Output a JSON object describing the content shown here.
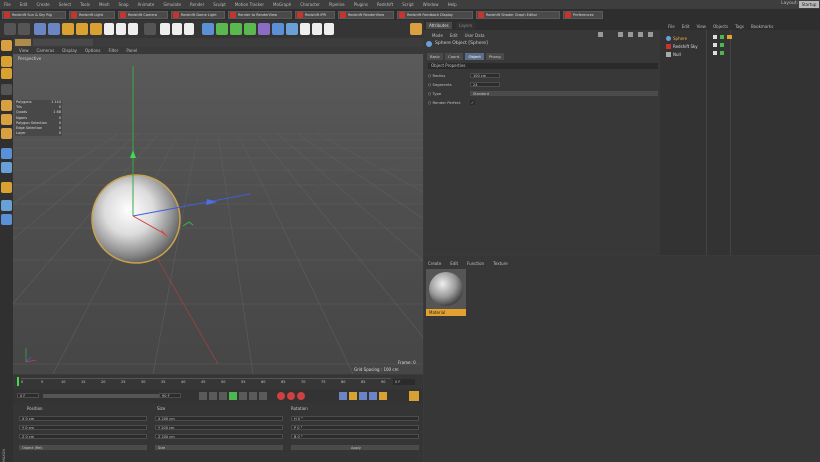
{
  "menubar": {
    "items": [
      "File",
      "Edit",
      "Create",
      "Select",
      "Tools",
      "Mesh",
      "Snap",
      "Animate",
      "Simulate",
      "Render",
      "Sculpt",
      "Motion Tracker",
      "MoGraph",
      "Character",
      "Pipeline",
      "Plugins",
      "Redshift",
      "Script",
      "Window",
      "Help"
    ],
    "layout_label": "Layout:",
    "layout_value": "Startup"
  },
  "plugin_bar": {
    "items": [
      "Redshift Sun & Sky Rig",
      "Redshift Light",
      "Redshift Camera",
      "Redshift Dome Light",
      "Render to RenderView",
      "Redshift IPR",
      "Redshift RenderView",
      "Redshift Feedback Display",
      "Redshift Shader Graph Editor",
      "Preferences"
    ]
  },
  "viewport": {
    "menu": [
      "View",
      "Cameras",
      "Display",
      "Options",
      "Filter",
      "Panel"
    ],
    "label": "Perspective",
    "hud": [
      {
        "k": "Polygons",
        "v": "1 144"
      },
      {
        "k": "Tris",
        "v": "0"
      },
      {
        "k": "Quads",
        "v": "1 88"
      },
      {
        "k": "Ngons",
        "v": "0"
      },
      {
        "k": "Polygon Selection",
        "v": "0"
      },
      {
        "k": "Edge Selection",
        "v": "0"
      },
      {
        "k": "Layer",
        "v": "0"
      }
    ],
    "frame_label": "Frame: 0",
    "grid_label": "Grid Spacing : 100 cm"
  },
  "timeline": {
    "ticks": [
      "0",
      "5",
      "10",
      "15",
      "20",
      "25",
      "30",
      "35",
      "40",
      "45",
      "50",
      "55",
      "60",
      "65",
      "70",
      "75",
      "80",
      "85",
      "90"
    ],
    "current_frame": "0 F",
    "start": "0 F",
    "end": "90 F"
  },
  "coords": {
    "headers": [
      "Position",
      "Size",
      "Rotation"
    ],
    "rows": [
      {
        "p": "X  0 cm",
        "s": "X  200 cm",
        "r": "H  0 °"
      },
      {
        "p": "Y  0 cm",
        "s": "Y  200 cm",
        "r": "P  0 °"
      },
      {
        "p": "Z  0 cm",
        "s": "Z  200 cm",
        "r": "B  0 °"
      }
    ],
    "mode": "Object (Rel)",
    "size_mode": "Size",
    "apply_label": "Apply"
  },
  "attributes": {
    "tabs": [
      "Attributes",
      "Layers"
    ],
    "menu": [
      "Mode",
      "Edit",
      "User Data"
    ],
    "object_name": "Sphere Object [Sphere]",
    "object_tabs": [
      "Basic",
      "Coord.",
      "Object",
      "Phong"
    ],
    "active_tab": "Object",
    "section": "Object Properties",
    "props": [
      {
        "label": "Radius",
        "value": "100 cm"
      },
      {
        "label": "Segments",
        "value": "24"
      },
      {
        "label": "Type",
        "value": "Standard"
      },
      {
        "label": "Render Perfect",
        "value": "✓"
      }
    ]
  },
  "object_manager": {
    "menu": [
      "File",
      "Edit",
      "View",
      "Objects",
      "Tags",
      "Bookmarks"
    ],
    "objects": [
      "Sphere",
      "Redshift Sky",
      "Null"
    ]
  },
  "material_manager": {
    "menu": [
      "Create",
      "Edit",
      "Function",
      "Texture"
    ],
    "material_name": "Material"
  }
}
